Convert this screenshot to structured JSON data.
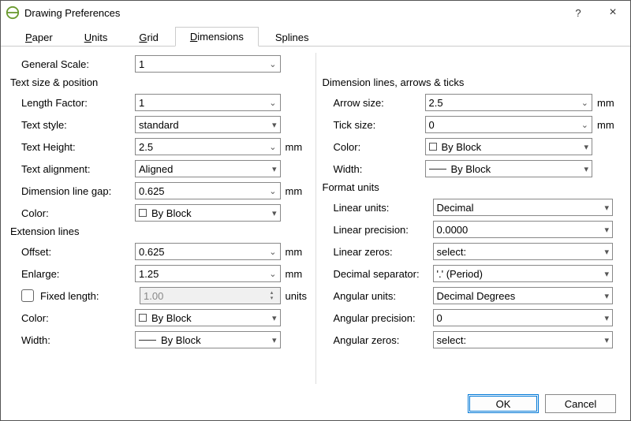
{
  "window": {
    "title": "Drawing Preferences",
    "help": "?",
    "close": "×"
  },
  "tabs": {
    "paper": "Paper",
    "units": "Units",
    "grid": "Grid",
    "dimensions": "Dimensions",
    "splines": "Splines"
  },
  "general": {
    "generalScaleLabel": "General Scale:",
    "generalScale": "1"
  },
  "textSize": {
    "heading": "Text size & position",
    "lengthFactorLabel": "Length Factor:",
    "lengthFactor": "1",
    "textStyleLabel": "Text style:",
    "textStyle": "standard",
    "textHeightLabel": "Text Height:",
    "textHeight": "2.5",
    "textHeightUnit": "mm",
    "textAlignLabel": "Text alignment:",
    "textAlign": "Aligned",
    "dimGapLabel": "Dimension line gap:",
    "dimGap": "0.625",
    "dimGapUnit": "mm",
    "colorLabel": "Color:",
    "color": "By Block"
  },
  "extLines": {
    "heading": "Extension lines",
    "offsetLabel": "Offset:",
    "offset": "0.625",
    "offsetUnit": "mm",
    "enlargeLabel": "Enlarge:",
    "enlarge": "1.25",
    "enlargeUnit": "mm",
    "fixedLenLabel": "Fixed length:",
    "fixedLen": "1.00",
    "fixedLenUnit": "units",
    "colorLabel": "Color:",
    "color": "By Block",
    "widthLabel": "Width:",
    "width": "By Block"
  },
  "dimLines": {
    "heading": "Dimension lines, arrows & ticks",
    "arrowLabel": "Arrow size:",
    "arrow": "2.5",
    "arrowUnit": "mm",
    "tickLabel": "Tick size:",
    "tick": "0",
    "tickUnit": "mm",
    "colorLabel": "Color:",
    "color": "By Block",
    "widthLabel": "Width:",
    "width": "By Block"
  },
  "formatUnits": {
    "heading": "Format units",
    "linUnitsLabel": "Linear units:",
    "linUnits": "Decimal",
    "linPrecLabel": "Linear precision:",
    "linPrec": "0.0000",
    "linZerosLabel": "Linear zeros:",
    "linZeros": "select:",
    "decSepLabel": "Decimal separator:",
    "decSep": "'.' (Period)",
    "angUnitsLabel": "Angular units:",
    "angUnits": "Decimal Degrees",
    "angPrecLabel": "Angular precision:",
    "angPrec": "0",
    "angZerosLabel": "Angular zeros:",
    "angZeros": "select:"
  },
  "footer": {
    "ok": "OK",
    "cancel": "Cancel"
  }
}
